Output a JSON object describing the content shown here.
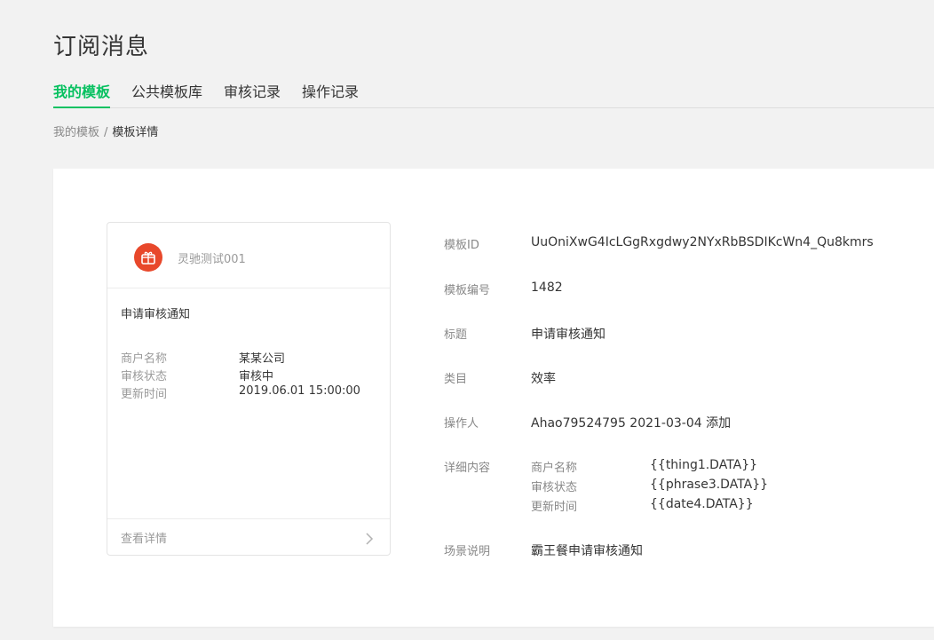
{
  "page": {
    "title": "订阅消息"
  },
  "tabs": [
    {
      "label": "我的模板",
      "active": true
    },
    {
      "label": "公共模板库",
      "active": false
    },
    {
      "label": "审核记录",
      "active": false
    },
    {
      "label": "操作记录",
      "active": false
    }
  ],
  "breadcrumb": {
    "parent": "我的模板",
    "separator": "/",
    "current": "模板详情"
  },
  "card": {
    "account_name": "灵驰测试001",
    "avatar_icon": "gift-box-icon",
    "avatar_color": "#e8482b",
    "title": "申请审核通知",
    "fields": [
      {
        "label": "商户名称",
        "value": "某某公司"
      },
      {
        "label": "审核状态",
        "value": "审核中"
      },
      {
        "label": "更新时间",
        "value": "2019.06.01 15:00:00"
      }
    ],
    "footer_label": "查看详情",
    "footer_icon": "chevron-right-icon"
  },
  "details": {
    "template_id": {
      "label": "模板ID",
      "value": "UuOniXwG4IcLGgRxgdwy2NYxRbBSDIKcWn4_Qu8kmrs"
    },
    "template_number": {
      "label": "模板编号",
      "value": "1482"
    },
    "title": {
      "label": "标题",
      "value": "申请审核通知"
    },
    "category": {
      "label": "类目",
      "value": "效率"
    },
    "operator": {
      "label": "操作人",
      "value": "Ahao79524795 2021-03-04 添加"
    },
    "content": {
      "label": "详细内容",
      "fields": [
        {
          "label": "商户名称",
          "value": "{{thing1.DATA}}"
        },
        {
          "label": "审核状态",
          "value": "{{phrase3.DATA}}"
        },
        {
          "label": "更新时间",
          "value": "{{date4.DATA}}"
        }
      ]
    },
    "scene": {
      "label": "场景说明",
      "value": "霸王餐申请审核通知"
    }
  },
  "colors": {
    "accent": "#07c160",
    "background": "#f2f2f2",
    "panel": "#ffffff"
  }
}
